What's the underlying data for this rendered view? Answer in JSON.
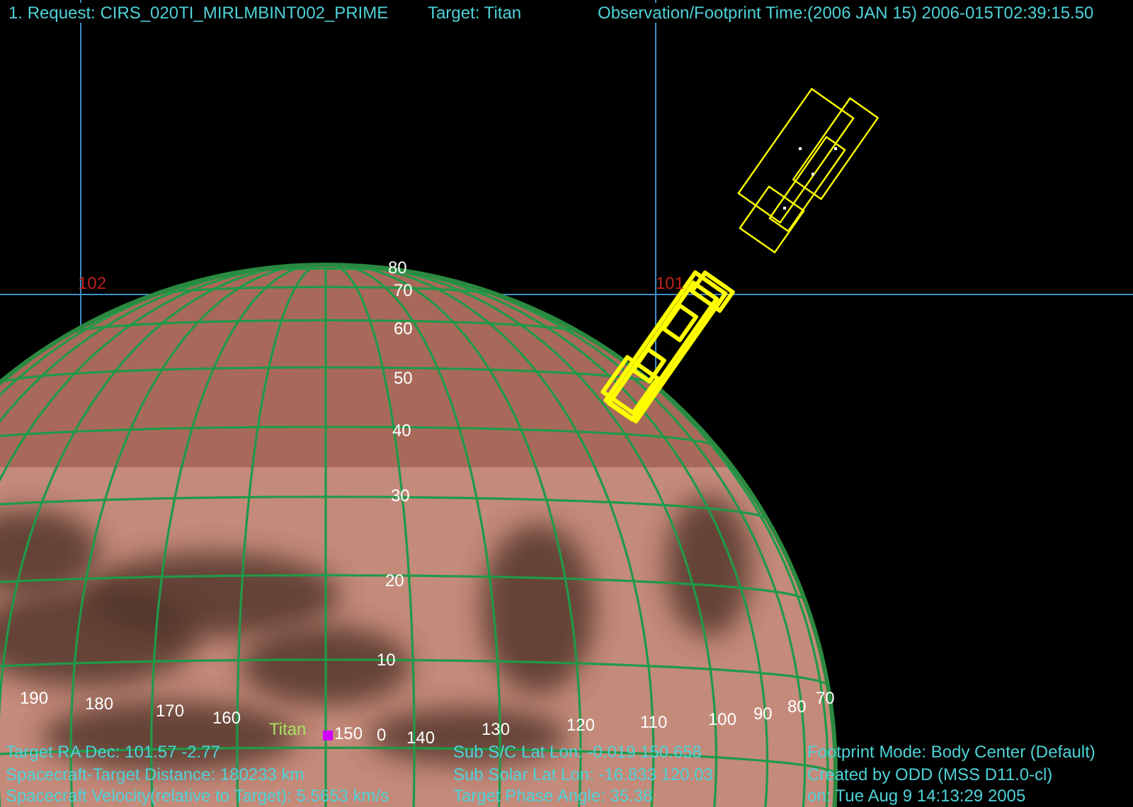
{
  "header": {
    "request": "1. Request:  CIRS_020TI_MIRLMBINT002_PRIME",
    "target": "Target: Titan",
    "time": "Observation/Footprint Time:(2006 JAN 15) 2006-015T02:39:15.50"
  },
  "ra_labels": [
    "102",
    "101"
  ],
  "latitude_labels": [
    "80",
    "70",
    "60",
    "50",
    "40",
    "30",
    "20",
    "10",
    "0"
  ],
  "longitude_labels": [
    "190",
    "180",
    "170",
    "160",
    "150",
    "140",
    "130",
    "120",
    "110",
    "100",
    "90",
    "80",
    "70"
  ],
  "target_label": "Titan",
  "info_left": [
    "Target RA  Dec: 101.57   -2.77",
    "Spacecraft-Target Distance:  180233 km",
    "Spacecraft Velocity(relative to Target): 5.5653 km/s"
  ],
  "info_center": [
    "Sub S/C Lat Lon: -0.019  150.658",
    "Sub Solar Lat Lon: -16.833  120.03",
    "Target Phase Angle: 35.38"
  ],
  "info_right": [
    "Footprint Mode: Body Center (Default)",
    "Created by ODD (MSS D11.0-cl)",
    "on: Tue Aug  9 14:13:29 2005"
  ]
}
